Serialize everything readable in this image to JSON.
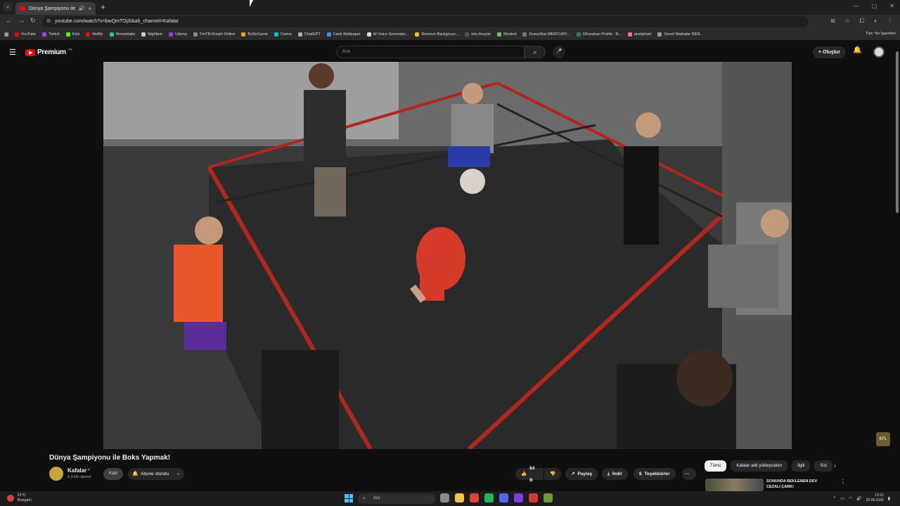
{
  "browser": {
    "tab_title": "Dünya Şampiyonu ile Boks",
    "tab_close": "×",
    "new_tab": "+",
    "url": "youtube.com/watch?v=bwQmTOj3I&ab_channel=Kafalar",
    "bookmarks": [
      {
        "label": "YouTube",
        "color": "#ff0000"
      },
      {
        "label": "Twitch",
        "color": "#9146ff"
      },
      {
        "label": "Kick",
        "color": "#53fc18"
      },
      {
        "label": "Netflix",
        "color": "#e50914"
      },
      {
        "label": "Streamlabs",
        "color": "#31c3a2"
      },
      {
        "label": "Nightbot",
        "color": "#cccccc"
      },
      {
        "label": "Udemy",
        "color": "#a435f0"
      },
      {
        "label": "FmTR-Knight Online",
        "color": "#888888"
      },
      {
        "label": "ByNoGame",
        "color": "#f0a500"
      },
      {
        "label": "Canva",
        "color": "#00c4cc"
      },
      {
        "label": "ChatGPT",
        "color": "#aaaaaa"
      },
      {
        "label": "Canlı Wallpaper",
        "color": "#4a90e2"
      },
      {
        "label": "AI Voice Generator...",
        "color": "#dddddd"
      },
      {
        "label": "Remove Backgroun...",
        "color": "#f7b733"
      },
      {
        "label": "tetu Araçlar",
        "color": "#555555"
      },
      {
        "label": "Moobot",
        "color": "#7fb77e"
      },
      {
        "label": "GravaStar MERCURY...",
        "color": "#777777"
      },
      {
        "label": "GKarahan Profile - B...",
        "color": "#3b7a57"
      },
      {
        "label": "pixelplush",
        "color": "#ff6f91"
      },
      {
        "label": "Genel Markalar REN...",
        "color": "#999999"
      }
    ],
    "bookmarks_right": "Tüm Yer İşaretleri"
  },
  "youtube": {
    "logo_text": "Premium",
    "logo_sup": "TR",
    "search_placeholder": "Ara",
    "create_label": "Oluştur",
    "video": {
      "title": "Dünya Şampiyonu ile Boks Yapmak!",
      "channel": "Kafalar",
      "subscribers": "6,3 Mn abone",
      "join_label": "Katıl",
      "subscribed_label": "Abone olundu",
      "likes": "84 B",
      "share_label": "Paylaş",
      "download_label": "İndir",
      "thanks_label": "Teşekkürler",
      "more_label": "···"
    },
    "filter_chips": [
      "Tümü",
      "Kafalar adlı yükleyiciden",
      "İlgili",
      "Sizi"
    ],
    "recommendation": {
      "title": "SONUNDA BEKLENEN DEV CEZALI ÇARK!"
    },
    "corner_badge": "KFL"
  },
  "taskbar": {
    "temp": "31°C",
    "weather": "Rüzgarlı",
    "search_placeholder": "Ara",
    "time": "13:10",
    "date": "20.08.2025",
    "icons": [
      {
        "name": "file-explorer-icon",
        "color": "#8a8a8a"
      },
      {
        "name": "folder-icon",
        "color": "#f4c542"
      },
      {
        "name": "chrome-icon",
        "color": "#db4437"
      },
      {
        "name": "spotify-icon",
        "color": "#1db954"
      },
      {
        "name": "discord-icon",
        "color": "#5865f2"
      },
      {
        "name": "app-icon",
        "color": "#7b3fe4"
      },
      {
        "name": "obs-icon",
        "color": "#d13a3a"
      },
      {
        "name": "game-icon",
        "color": "#6a9b3a"
      }
    ]
  }
}
